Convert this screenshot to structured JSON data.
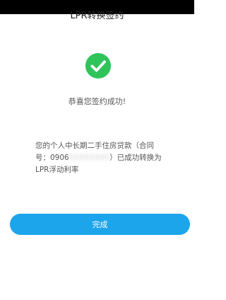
{
  "header": {
    "title": "LPR转换签约"
  },
  "result": {
    "icon": "check-icon",
    "icon_color": "#2ec45a",
    "message": "恭喜您签约成功!"
  },
  "detail": {
    "line1": "您的个人中长期二手住房贷款（合同",
    "line2_prefix": "号：0906",
    "line2_masked": "XXXXXXXX",
    "line2_suffix": "）已成功转换为",
    "line3": "LPR浮动利率"
  },
  "actions": {
    "done_label": "完成",
    "button_color": "#1da5ec"
  }
}
